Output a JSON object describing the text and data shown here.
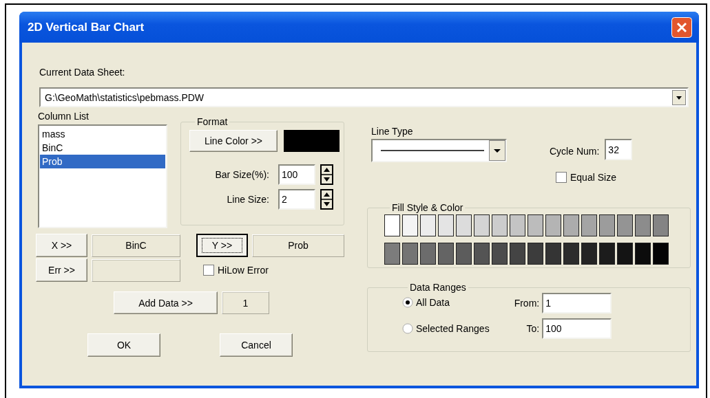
{
  "window": {
    "title": "2D Vertical Bar Chart"
  },
  "data_sheet": {
    "label": "Current Data Sheet:",
    "value": "G:\\GeoMath\\statistics\\pebmass.PDW"
  },
  "column_list": {
    "label": "Column List",
    "items": [
      {
        "label": "mass",
        "selected": false
      },
      {
        "label": "BinC",
        "selected": false
      },
      {
        "label": "Prob",
        "selected": true
      }
    ]
  },
  "format": {
    "title": "Format",
    "line_color_button": "Line Color >>",
    "color": "#000000",
    "bar_size": {
      "label": "Bar Size(%):",
      "value": "100"
    },
    "line_size": {
      "label": "Line Size:",
      "value": "2"
    }
  },
  "axes": [
    {
      "button": "X >>",
      "value": "BinC",
      "focused": false
    },
    {
      "button": "Y >>",
      "value": "Prob",
      "focused": true
    },
    {
      "button": "Err >>",
      "focused": false
    }
  ],
  "hilow_error": {
    "label": "HiLow Error",
    "checked": false
  },
  "add_data": {
    "button": "Add Data >>",
    "count": "1"
  },
  "buttons": [
    "OK",
    "Cancel"
  ],
  "line_type": {
    "label": "Line Type"
  },
  "cycle_num": {
    "label": "Cycle Num:",
    "value": "32"
  },
  "equal_size": {
    "label": "Equal Size",
    "checked": false
  },
  "fill_style": {
    "title": "Fill Style & Color",
    "swatches": [
      {
        "color": "#ffffff"
      },
      {
        "color": "#f4f4f4"
      },
      {
        "color": "#ececec"
      },
      {
        "color": "#e4e4e4"
      },
      {
        "color": "#dcdcdc"
      },
      {
        "color": "#d4d4d4"
      },
      {
        "color": "#cccccc"
      },
      {
        "color": "#c4c4c4"
      },
      {
        "color": "#bcbcbc"
      },
      {
        "color": "#b4b4b4"
      },
      {
        "color": "#acacac"
      },
      {
        "color": "#a4a4a4"
      },
      {
        "color": "#9c9c9c"
      },
      {
        "color": "#949494"
      },
      {
        "color": "#8c8c8c"
      },
      {
        "color": "#848484"
      },
      {
        "color": "#7c7c7c"
      },
      {
        "color": "#747474"
      },
      {
        "color": "#6c6c6c"
      },
      {
        "color": "#646464"
      },
      {
        "color": "#5c5c5c"
      },
      {
        "color": "#545454"
      },
      {
        "color": "#4c4c4c"
      },
      {
        "color": "#444444"
      },
      {
        "color": "#3c3c3c"
      },
      {
        "color": "#343434"
      },
      {
        "color": "#2c2c2c"
      },
      {
        "color": "#242424"
      },
      {
        "color": "#1c1c1c"
      },
      {
        "color": "#141414"
      },
      {
        "color": "#0c0c0c"
      },
      {
        "color": "#040404"
      }
    ]
  },
  "data_ranges": {
    "title": "Data Ranges",
    "options": [
      {
        "label": "All Data",
        "selected": true
      },
      {
        "label": "Selected Ranges",
        "selected": false
      }
    ],
    "from": {
      "label": "From:",
      "value": "1"
    },
    "to": {
      "label": "To:",
      "value": "100"
    }
  }
}
